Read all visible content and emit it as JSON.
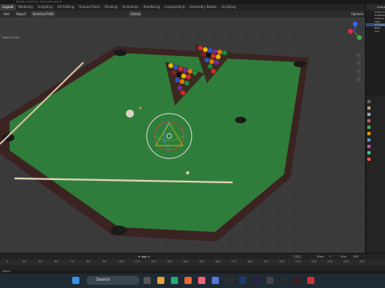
{
  "topbar": {
    "text": "Blender [C:\\Users\\...\\pool_table.blend]"
  },
  "tabs": [
    "Layout",
    "Modeling",
    "Sculpting",
    "UV Editing",
    "Texture Paint",
    "Shading",
    "Animation",
    "Rendering",
    "Compositing",
    "Geometry Nodes",
    "Scripting"
  ],
  "scene": {
    "label": "Scene"
  },
  "header": {
    "mode": "Add",
    "object": "Object",
    "view": "Relative Path",
    "transform": "Global",
    "options": "Options"
  },
  "header2": {
    "text": "Object Mode"
  },
  "outliner": {
    "rows": [
      "Scene Collection",
      "Collection",
      "Camera",
      "Light",
      "PoolTable",
      "Balls",
      "Cue"
    ]
  },
  "timeline": {
    "frame_current": "1",
    "start_label": "Start",
    "start": "1",
    "end_label": "End",
    "end": "250",
    "ticks": [
      "0",
      "40",
      "50",
      "60",
      "70",
      "80",
      "90",
      "100",
      "110",
      "120",
      "130",
      "140",
      "150",
      "160",
      "170",
      "180",
      "190",
      "200",
      "210",
      "220",
      "230",
      "240",
      "250"
    ]
  },
  "status": {
    "text": "Object"
  },
  "taskbar": {
    "search_placeholder": "Search"
  },
  "colors": {
    "felt": "#2f7d3a",
    "rail": "#3b2321",
    "accent": "#334d80",
    "bg": "#3a3a3a"
  }
}
